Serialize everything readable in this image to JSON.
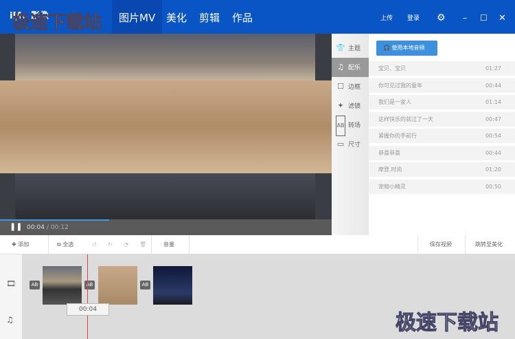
{
  "header": {
    "logo": "iMo 影像",
    "tabs": [
      "图片MV",
      "美化",
      "剪辑",
      "作品"
    ],
    "upload": "上传",
    "login": "登录"
  },
  "player": {
    "current": "00:04",
    "total": "/ 00:12",
    "progress": 0.33
  },
  "sidebar": [
    "主题",
    "配乐",
    "边框",
    "滤镜",
    "转场",
    "尺寸"
  ],
  "music": {
    "local_button": "使用本地音频",
    "tracks": [
      {
        "name": "宝贝、宝贝",
        "dur": "01:27"
      },
      {
        "name": "你可见过我的童年",
        "dur": "00:44"
      },
      {
        "name": "我们是一家人",
        "dur": "01:14"
      },
      {
        "name": "这样快乐的就过了一天",
        "dur": "00:47"
      },
      {
        "name": "紧握你的手前行",
        "dur": "00:54"
      },
      {
        "name": "恭喜恭喜",
        "dur": "00:44"
      },
      {
        "name": "摩登.时尚",
        "dur": "01:20"
      },
      {
        "name": "宠物小精灵",
        "dur": "00:50"
      }
    ]
  },
  "toolbar": {
    "add": "添加",
    "select_all": "全选",
    "volume": "音量",
    "save": "保存视频",
    "goto": "跳转至美化"
  },
  "timeline": {
    "time": "00:04",
    "ab": "AB"
  },
  "watermark": "极速下载站"
}
